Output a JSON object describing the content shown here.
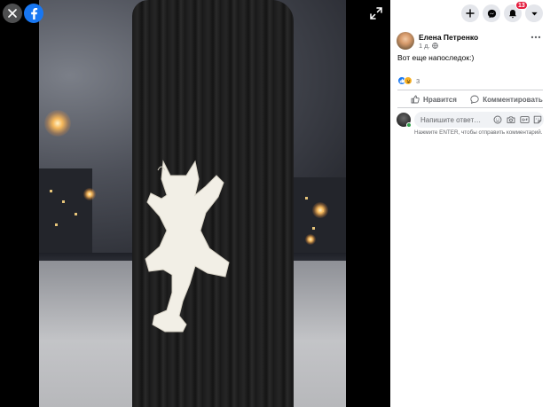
{
  "viewer": {
    "close_icon": "close-icon",
    "logo_icon": "facebook-logo-icon",
    "expand_icon": "expand-icon"
  },
  "topbar": {
    "create_icon": "plus-icon",
    "messenger_icon": "messenger-icon",
    "notifications_icon": "bell-icon",
    "notifications_count": "13",
    "account_icon": "caret-down-icon"
  },
  "post": {
    "author": "Елена Петренко",
    "time": "1 д.",
    "audience_icon": "globe-icon",
    "text": "Вот еще напоследок:)",
    "reactions": {
      "types": [
        "like",
        "haha"
      ],
      "count": "3"
    }
  },
  "actions": {
    "like_label": "Нравится",
    "comment_label": "Комментировать"
  },
  "comment": {
    "placeholder": "Напишите ответ…",
    "hint": "Нажмите ENTER, чтобы отправить комментарий."
  },
  "colors": {
    "brand": "#1877f2",
    "badge": "#e41e3f",
    "online": "#31a24c",
    "secondary_text": "#65676b"
  }
}
